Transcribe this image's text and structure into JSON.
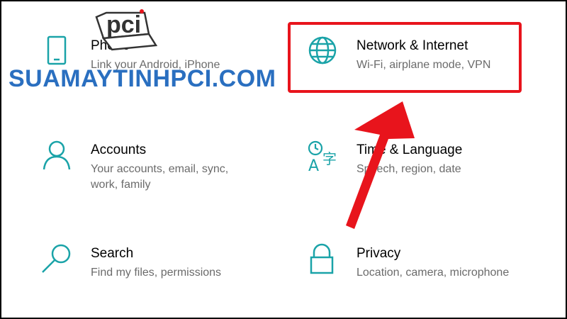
{
  "watermark": {
    "logo_text": "pci",
    "site_text": "SUAMAYTINHPCI.COM"
  },
  "settings": {
    "phone": {
      "title": "Phone",
      "description": "Link your Android, iPhone",
      "icon": "phone-icon"
    },
    "network": {
      "title": "Network & Internet",
      "description": "Wi-Fi, airplane mode, VPN",
      "icon": "globe-icon"
    },
    "accounts": {
      "title": "Accounts",
      "description": "Your accounts, email, sync, work, family",
      "icon": "person-icon"
    },
    "time": {
      "title": "Time & Language",
      "description": "Speech, region, date",
      "icon": "time-language-icon"
    },
    "search": {
      "title": "Search",
      "description": "Find my files, permissions",
      "icon": "magnifier-icon"
    },
    "privacy": {
      "title": "Privacy",
      "description": "Location, camera, microphone",
      "icon": "lock-icon"
    }
  },
  "colors": {
    "accent": "#1aa3a8",
    "highlight": "#e8141c",
    "title_text": "#000000",
    "description_text": "#6b6b6b"
  }
}
